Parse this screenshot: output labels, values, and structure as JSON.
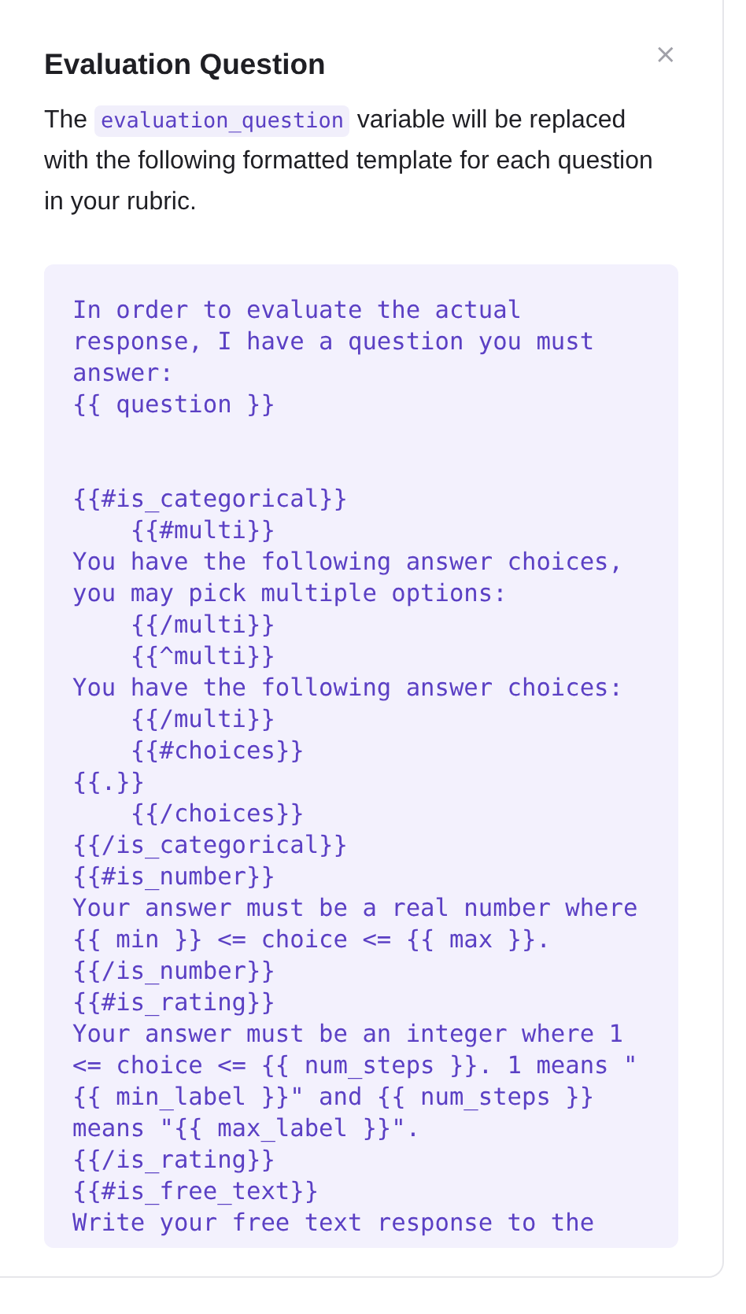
{
  "dialog": {
    "title": "Evaluation Question",
    "close": "×",
    "description": {
      "before": "The",
      "code": "evaluation_question",
      "after": "variable will be replaced with the following formatted template for each question in your rubric."
    },
    "template": "In order to evaluate the actual response, I have a question you must answer:\n{{ question }}\n\n\n{{#is_categorical}}\n    {{#multi}}\nYou have the following answer choices, you may pick multiple options:\n    {{/multi}}\n    {{^multi}}\nYou have the following answer choices:\n    {{/multi}}\n    {{#choices}}\n{{.}}\n    {{/choices}}\n{{/is_categorical}}\n{{#is_number}}\nYour answer must be a real number where {{ min }} <= choice <= {{ max }}.\n{{/is_number}}\n{{#is_rating}}\nYour answer must be an integer where 1 <= choice <= {{ num_steps }}. 1 means \"{{ min_label }}\" and {{ num_steps }} means \"{{ max_label }}\".\n{{/is_rating}}\n{{#is_free_text}}\nWrite your free text response to the"
  }
}
